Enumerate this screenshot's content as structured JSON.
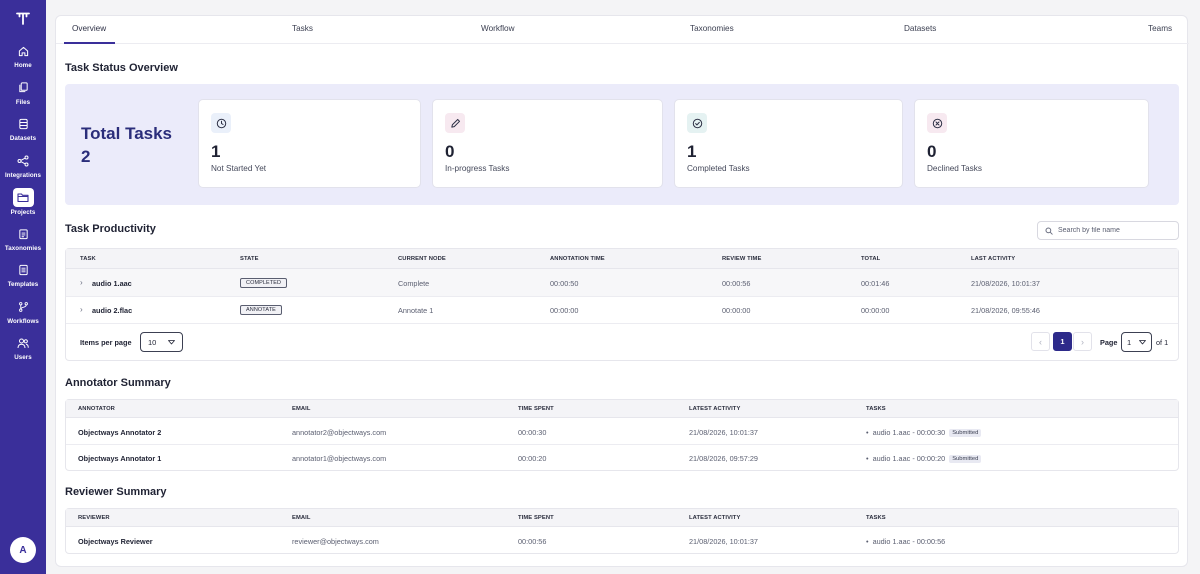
{
  "sidebar": {
    "logo_icon": "brand-logo-icon",
    "items": [
      {
        "label": "Home",
        "icon": "home-icon"
      },
      {
        "label": "Files",
        "icon": "files-icon"
      },
      {
        "label": "Datasets",
        "icon": "database-icon"
      },
      {
        "label": "Integrations",
        "icon": "share-icon"
      },
      {
        "label": "Projects",
        "icon": "folder-icon",
        "active": true
      },
      {
        "label": "Taxonomies",
        "icon": "clipboard-icon"
      },
      {
        "label": "Templates",
        "icon": "template-icon"
      },
      {
        "label": "Workflows",
        "icon": "branch-icon"
      },
      {
        "label": "Users",
        "icon": "users-icon"
      }
    ],
    "avatar": "A"
  },
  "tabs": [
    "Overview",
    "Tasks",
    "Workflow",
    "Taxonomies",
    "Datasets",
    "Teams"
  ],
  "overview": {
    "title": "Task Status Overview",
    "total_label": "Total Tasks",
    "total_value": "2",
    "cards": [
      {
        "value": "1",
        "label": "Not Started Yet",
        "icon": "clock-icon",
        "color": "#eaf0fa"
      },
      {
        "value": "0",
        "label": "In-progress Tasks",
        "icon": "pencil-icon",
        "color": "#f7e9f0"
      },
      {
        "value": "1",
        "label": "Completed Tasks",
        "icon": "check-circle-icon",
        "color": "#e5f2f2"
      },
      {
        "value": "0",
        "label": "Declined Tasks",
        "icon": "x-circle-icon",
        "color": "#f7e9f0"
      }
    ]
  },
  "productivity": {
    "title": "Task Productivity",
    "search_placeholder": "Search by file name",
    "headers": [
      "TASK",
      "STATE",
      "CURRENT NODE",
      "ANNOTATION TIME",
      "REVIEW TIME",
      "TOTAL",
      "LAST ACTIVITY"
    ],
    "rows": [
      {
        "task": "audio 1.aac",
        "state": "COMPLETED",
        "node": "Complete",
        "annotation": "00:00:50",
        "review": "00:00:56",
        "total": "00:01:46",
        "last": "21/08/2026, 10:01:37"
      },
      {
        "task": "audio 2.flac",
        "state": "ANNOTATE",
        "node": "Annotate 1",
        "annotation": "00:00:00",
        "review": "00:00:00",
        "total": "00:00:00",
        "last": "21/08/2026, 09:55:46"
      }
    ],
    "items_per_page_label": "Items per page",
    "items_per_page": "10",
    "current_page": "1",
    "page_label": "Page",
    "page_select": "1",
    "of_label": "of 1"
  },
  "annotators": {
    "title": "Annotator Summary",
    "headers": [
      "ANNOTATOR",
      "EMAIL",
      "TIME SPENT",
      "LATEST ACTIVITY",
      "TASKS"
    ],
    "rows": [
      {
        "name": "Objectways Annotator 2",
        "email": "annotator2@objectways.com",
        "time": "00:00:30",
        "latest": "21/08/2026, 10:01:37",
        "task": "audio 1.aac - 00:00:30",
        "status": "Submitted"
      },
      {
        "name": "Objectways Annotator 1",
        "email": "annotator1@objectways.com",
        "time": "00:00:20",
        "latest": "21/08/2026, 09:57:29",
        "task": "audio 1.aac - 00:00:20",
        "status": "Submitted"
      }
    ]
  },
  "reviewers": {
    "title": "Reviewer Summary",
    "headers": [
      "REVIEWER",
      "EMAIL",
      "TIME SPENT",
      "LATEST ACTIVITY",
      "TASKS"
    ],
    "rows": [
      {
        "name": "Objectways Reviewer",
        "email": "reviewer@objectways.com",
        "time": "00:00:56",
        "latest": "21/08/2026, 10:01:37",
        "task": "audio 1.aac - 00:00:56"
      }
    ]
  }
}
